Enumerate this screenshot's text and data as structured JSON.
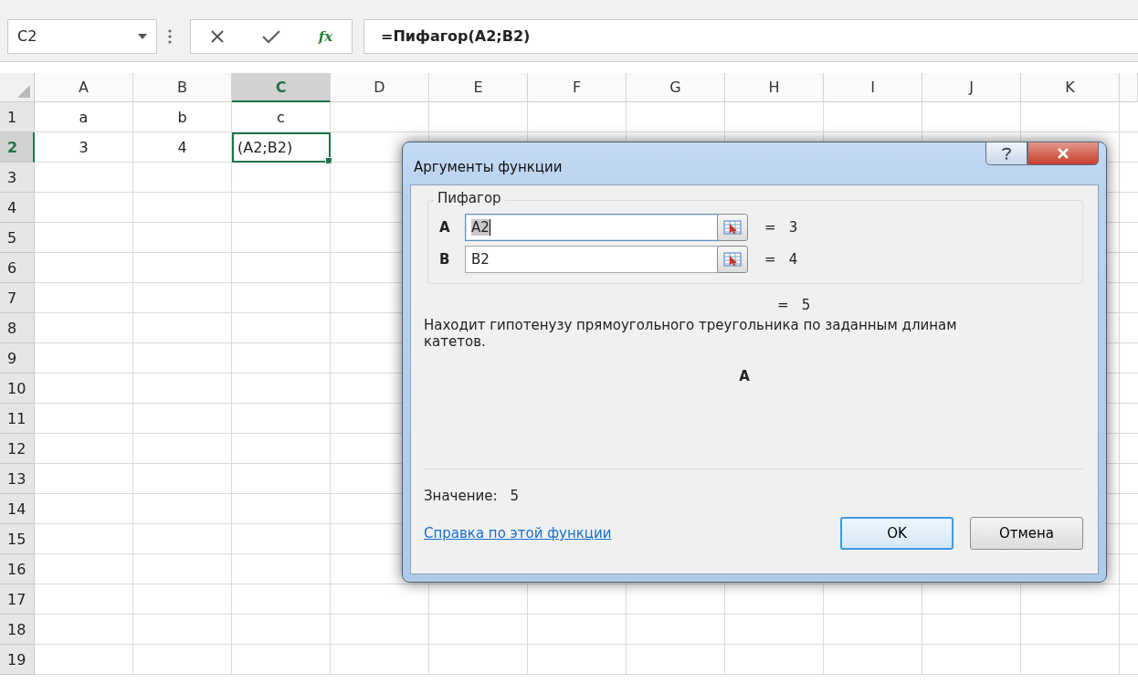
{
  "formula_bar": {
    "name_box": "C2",
    "fx": "fx",
    "formula": "=Пифагор(A2;B2)"
  },
  "sheet": {
    "columns": [
      {
        "label": "A",
        "selected": false
      },
      {
        "label": "B",
        "selected": false
      },
      {
        "label": "C",
        "selected": true
      },
      {
        "label": "D",
        "selected": false
      },
      {
        "label": "E",
        "selected": false
      },
      {
        "label": "F",
        "selected": false
      },
      {
        "label": "G",
        "selected": false
      },
      {
        "label": "H",
        "selected": false
      },
      {
        "label": "I",
        "selected": false
      },
      {
        "label": "J",
        "selected": false
      },
      {
        "label": "K",
        "selected": false
      }
    ],
    "rows": [
      {
        "label": "1",
        "selected": false,
        "cells": [
          {
            "text": "a",
            "selected": false
          },
          {
            "text": "b",
            "selected": false
          },
          {
            "text": "c",
            "selected": false
          }
        ]
      },
      {
        "label": "2",
        "selected": true,
        "cells": [
          {
            "text": "3",
            "selected": false
          },
          {
            "text": "4",
            "selected": false
          },
          {
            "text": "(A2;B2)",
            "selected": true
          }
        ]
      },
      {
        "label": "3",
        "selected": false
      },
      {
        "label": "4",
        "selected": false
      },
      {
        "label": "5",
        "selected": false
      },
      {
        "label": "6",
        "selected": false
      },
      {
        "label": "7",
        "selected": false
      },
      {
        "label": "8",
        "selected": false
      },
      {
        "label": "9",
        "selected": false
      },
      {
        "label": "10",
        "selected": false
      },
      {
        "label": "11",
        "selected": false
      },
      {
        "label": "12",
        "selected": false
      },
      {
        "label": "13",
        "selected": false
      },
      {
        "label": "14",
        "selected": false
      },
      {
        "label": "15",
        "selected": false
      },
      {
        "label": "16",
        "selected": false
      },
      {
        "label": "17",
        "selected": false
      },
      {
        "label": "18",
        "selected": false
      },
      {
        "label": "19",
        "selected": false
      }
    ]
  },
  "dialog": {
    "title": "Аргументы функции",
    "function_name": "Пифагор",
    "arguments": [
      {
        "label": "A",
        "value": "A2",
        "result": "=   3",
        "focused": true
      },
      {
        "label": "B",
        "value": "B2",
        "result": "=   4",
        "focused": false
      }
    ],
    "result": "=   5",
    "description": "Находит гипотенузу прямоугольного треугольника по заданным длинам катетов.",
    "argument_help": "A",
    "value_label": "Значение:",
    "value": "5",
    "help_link": "Справка по этой функции",
    "buttons": [
      {
        "label": "OK",
        "default": true
      },
      {
        "label": "Отмена",
        "default": false
      }
    ]
  }
}
